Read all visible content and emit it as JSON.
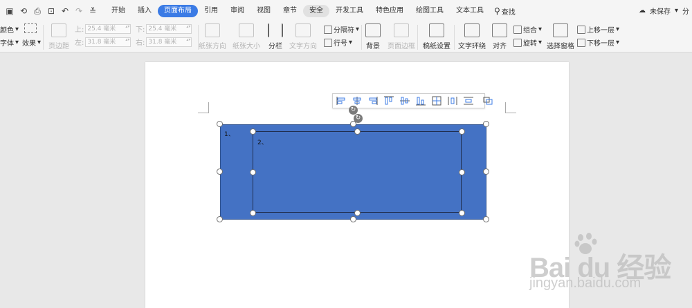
{
  "quick_access": {
    "icons": [
      "save-icon",
      "save-as-icon",
      "print-icon",
      "print-preview-icon",
      "undo-icon",
      "redo-icon",
      "customize-icon"
    ]
  },
  "menu": {
    "tabs": [
      "开始",
      "插入",
      "页面布局",
      "引用",
      "审阅",
      "视图",
      "章节",
      "安全",
      "开发工具",
      "特色应用",
      "绘图工具",
      "文本工具"
    ],
    "active_tab": "页面布局",
    "search_label": "查找",
    "unsaved_label": "未保存",
    "share_label": "分"
  },
  "ribbon": {
    "color_label": "颜色",
    "font_label": "字体",
    "effect_label": "效果",
    "margins_label": "页边距",
    "top_label": "上:",
    "top_value": "25.4 毫米",
    "bottom_label": "下:",
    "bottom_value": "25.4 毫米",
    "left_label": "左:",
    "left_value": "31.8 毫米",
    "right_label": "右:",
    "right_value": "31.8 毫米",
    "orientation_label": "纸张方向",
    "paper_size_label": "纸张大小",
    "columns_label": "分栏",
    "text_direction_label": "文字方向",
    "separator_label": "分隔符",
    "line_number_label": "行号",
    "background_label": "背景",
    "page_border_label": "页面边框",
    "manuscript_label": "稿纸设置",
    "text_wrap_label": "文字环绕",
    "align_label": "对齐",
    "group_label": "组合",
    "rotate_label": "旋转",
    "selection_pane_label": "选择窗格",
    "bring_forward_label": "上移一层",
    "send_backward_label": "下移一层"
  },
  "shapes": {
    "outer_label": "1、",
    "inner_label": "2、",
    "fill_color": "#4472c4",
    "stroke_color": "#2f528f"
  },
  "watermark": {
    "brand": "Bai du 经验",
    "sub": "jingyan.baidu.com"
  },
  "colors": {
    "accent": "#3b7be5",
    "ribbon_bg": "#f5f5f5",
    "canvas_bg": "#e8e8e8"
  }
}
